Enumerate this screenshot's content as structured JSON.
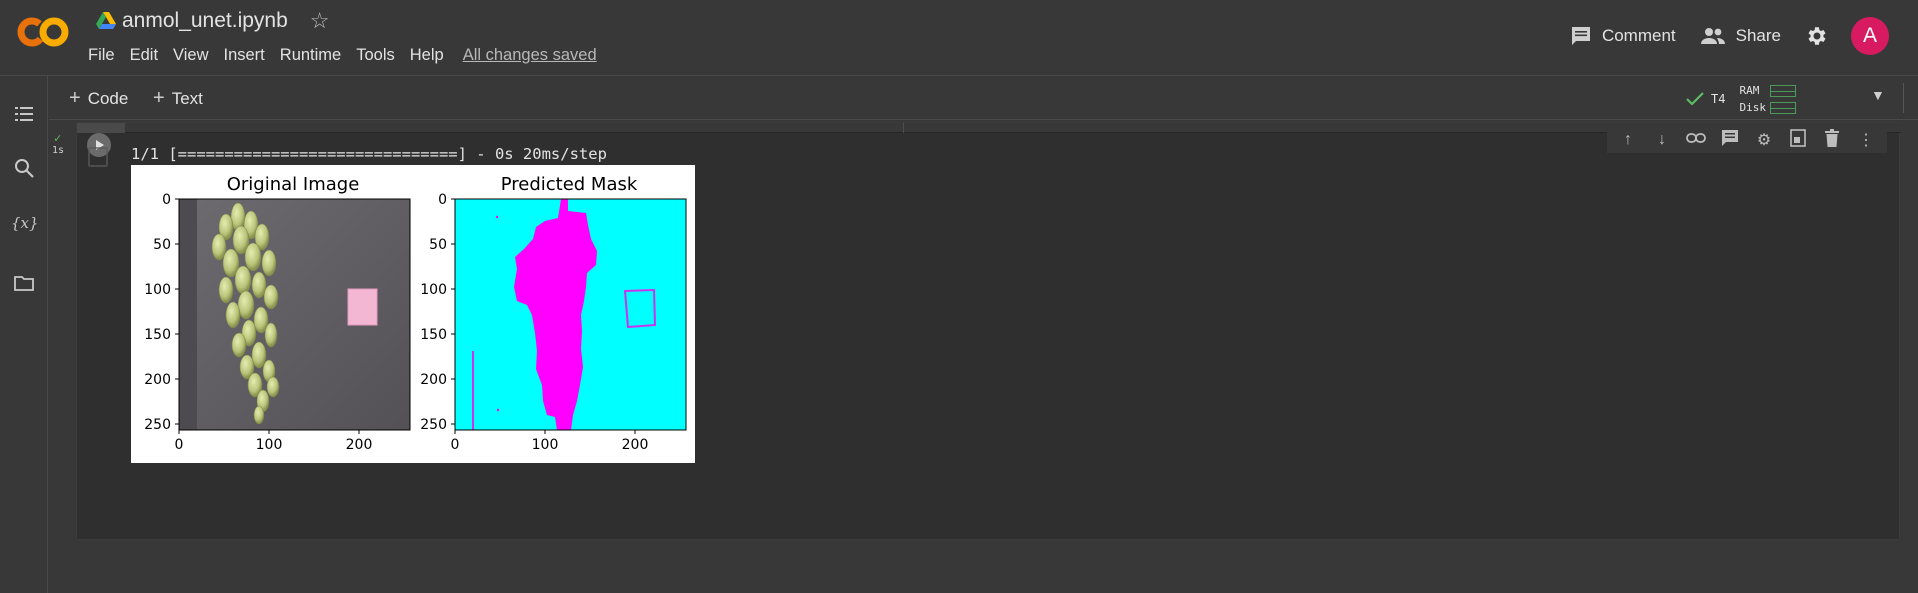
{
  "header": {
    "notebook_title": "anmol_unet.ipynb",
    "menu": [
      "File",
      "Edit",
      "View",
      "Insert",
      "Runtime",
      "Tools",
      "Help"
    ],
    "save_status": "All changes saved",
    "comment_label": "Comment",
    "share_label": "Share",
    "avatar_letter": "A",
    "logo_text": "CO"
  },
  "toolbar": {
    "code_label": "Code",
    "text_label": "Text",
    "runtime_type": "T4",
    "ram_label": "RAM",
    "disk_label": "Disk"
  },
  "cell": {
    "exec_time": "1s",
    "output_text": "1/1 [==============================] - 0s 20ms/step"
  },
  "chart_data": [
    {
      "type": "image",
      "title": "Original Image",
      "xticks": [
        "0",
        "100",
        "200"
      ],
      "yticks": [
        "0",
        "50",
        "100",
        "150",
        "200",
        "250"
      ],
      "xlim": [
        0,
        255
      ],
      "ylim": [
        255,
        0
      ],
      "content": "grapes"
    },
    {
      "type": "image",
      "title": "Predicted Mask",
      "xticks": [
        "0",
        "100",
        "200"
      ],
      "yticks": [
        "0",
        "50",
        "100",
        "150",
        "200",
        "250"
      ],
      "xlim": [
        0,
        255
      ],
      "ylim": [
        255,
        0
      ],
      "colors": {
        "background": "#00ffff",
        "mask": "#ff00ff"
      }
    }
  ],
  "colors": {
    "accent_green": "#5dbb63",
    "avatar_bg": "#d81b60",
    "logo_orange": "#f9ab00",
    "logo_dark_orange": "#e8710a"
  }
}
